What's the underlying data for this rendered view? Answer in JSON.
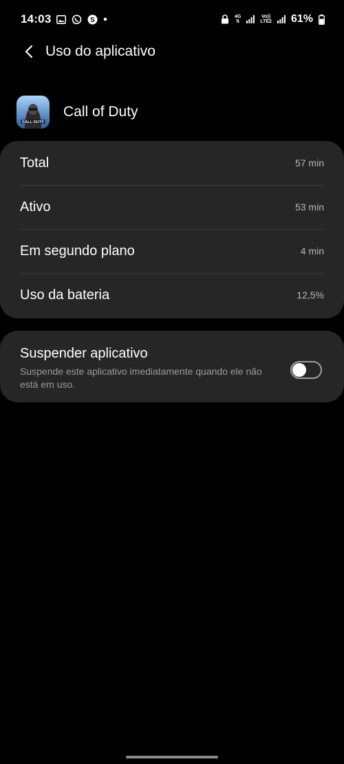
{
  "status_bar": {
    "time": "14:03",
    "network_4g": "4G",
    "volte_top": "Vo))",
    "volte_bottom": "LTE2",
    "battery_percent": "61%"
  },
  "header": {
    "title": "Uso do aplicativo"
  },
  "app": {
    "name": "Call of Duty",
    "icon_text": "CALL·DUTY"
  },
  "usage": {
    "rows": [
      {
        "label": "Total",
        "value": "57 min"
      },
      {
        "label": "Ativo",
        "value": "53 min"
      },
      {
        "label": "Em segundo plano",
        "value": "4 min"
      },
      {
        "label": "Uso da bateria",
        "value": "12,5%"
      }
    ]
  },
  "suspend": {
    "title": "Suspender aplicativo",
    "description": "Suspende este aplicativo imediatamente quando ele não está em uso.",
    "toggle_on": false
  },
  "colors": {
    "background": "#000000",
    "card": "#262626",
    "secondary_text": "#b9b9b9"
  },
  "icons": [
    "gallery-icon",
    "whatsapp-icon",
    "skype-icon",
    "notification-dot-icon",
    "lock-icon",
    "signal-icon",
    "battery-icon",
    "back-arrow-icon"
  ]
}
